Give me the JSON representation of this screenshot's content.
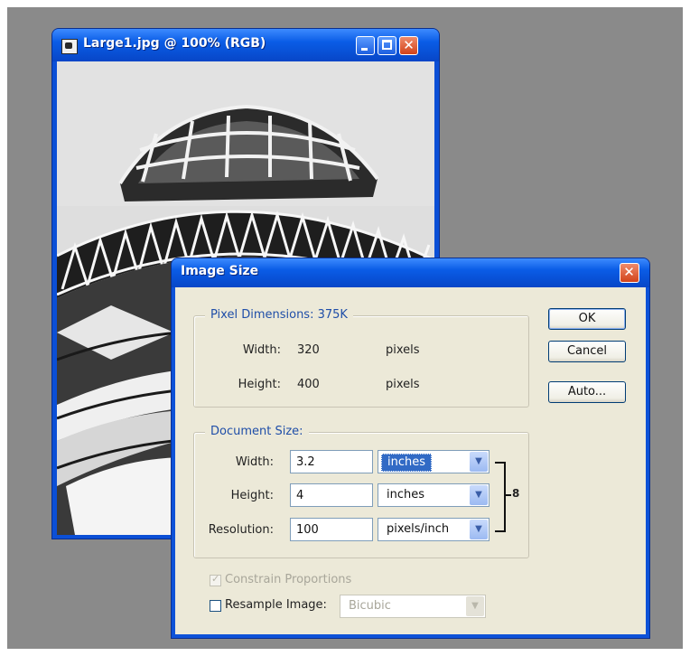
{
  "image_window": {
    "title": "Large1.jpg @ 100% (RGB)",
    "close_glyph": "✕"
  },
  "dialog": {
    "title": "Image Size",
    "close_glyph": "✕",
    "pixel_dimensions": {
      "legend": "Pixel Dimensions:",
      "size": "375K",
      "width_label": "Width:",
      "width_value": "320",
      "width_unit": "pixels",
      "height_label": "Height:",
      "height_value": "400",
      "height_unit": "pixels"
    },
    "document_size": {
      "legend": "Document Size:",
      "width_label": "Width:",
      "width_value": "3.2",
      "width_unit": "inches",
      "height_label": "Height:",
      "height_value": "4",
      "height_unit": "inches",
      "resolution_label": "Resolution:",
      "resolution_value": "100",
      "resolution_unit": "pixels/inch"
    },
    "buttons": {
      "ok": "OK",
      "cancel": "Cancel",
      "auto": "Auto..."
    },
    "constrain_proportions": {
      "label": "Constrain Proportions",
      "checked": true,
      "enabled": false
    },
    "resample_image": {
      "label": "Resample Image:",
      "checked": false,
      "method": "Bicubic",
      "method_enabled": false
    },
    "chain_glyph": "8",
    "arrow_glyph": "▼",
    "check_glyph": "✓"
  }
}
